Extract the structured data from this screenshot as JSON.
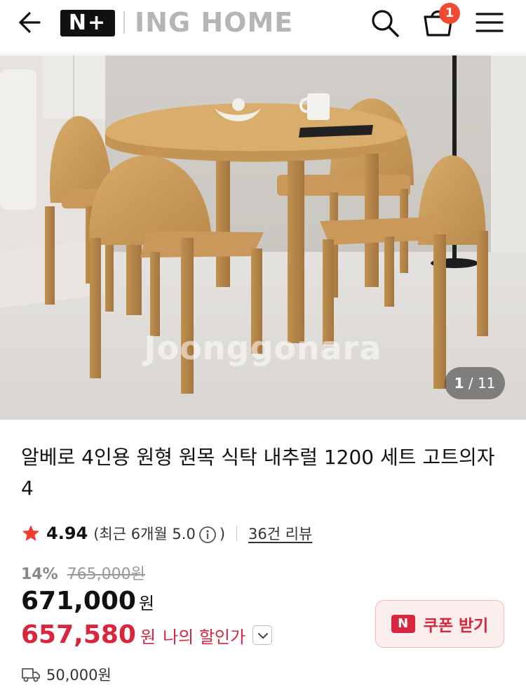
{
  "header": {
    "logo_badge": "N+",
    "brand": "ING HOME",
    "cart_count": "1"
  },
  "hero": {
    "watermark": "Joonggonara",
    "page_current": "1",
    "page_total": "/ 11"
  },
  "product": {
    "title": "알베로 4인용 원형 원목 식탁 내추럴 1200 세트 고트의자 4",
    "rating_score": "4.94",
    "rating_recent_prefix": "(최근 6개월 5.0",
    "rating_recent_suffix": ")",
    "reviews": "36건 리뷰",
    "discount_rate": "14%",
    "original_price": "765,000원",
    "price": "671,000",
    "price_unit": "원",
    "my_price": "657,580",
    "my_price_unit": "원",
    "my_price_label": "나의 할인가",
    "coupon_badge": "N",
    "coupon_label": "쿠폰 받기",
    "shipping_fee": "50,000원"
  },
  "colors": {
    "accent_red": "#d7263d",
    "badge_red": "#f24a31",
    "star": "#f03c2e"
  }
}
